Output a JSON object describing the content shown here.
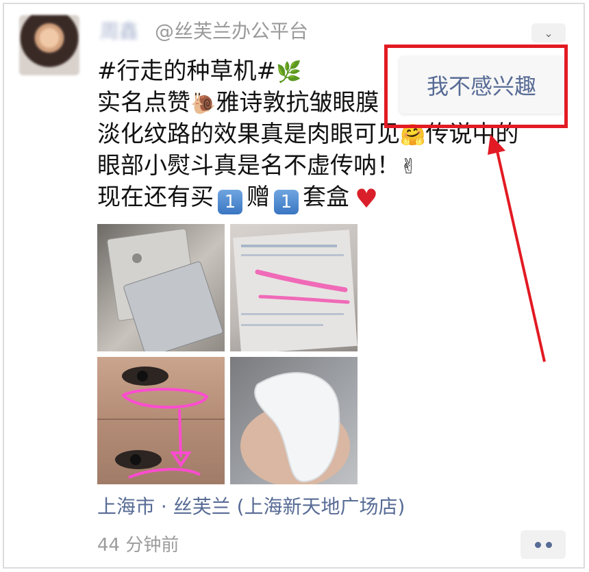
{
  "post": {
    "author_name": "周鑫",
    "handle": "@丝芙兰办公平台",
    "lines": {
      "line1_text": "#行走的种草机#",
      "line1_emoji": "🌿",
      "line2_text_a": "实名点赞",
      "line2_emoji": "🐌",
      "line2_text_b": "雅诗敦抗皱眼膜",
      "line3_text_a": "淡化纹路的效果真是肉眼可见",
      "line3_emoji": "🤗",
      "line3_text_b": "传说中的",
      "line4_text": "眼部小熨斗真是名不虚传呐！",
      "line4_emoji": "✌",
      "line5_text_a": "现在还有买",
      "keycap_1": "1",
      "line5_text_b": "赠",
      "keycap_2": "1",
      "line5_text_c": "套盒",
      "heart": "♥"
    },
    "location": "上海市 · 丝芙兰 (上海新天地广场店)",
    "time": "44 分钟前"
  },
  "menu": {
    "not_interested": "我不感兴趣"
  },
  "icons": {
    "more": "chevron-down-icon",
    "actions": "more-dots-icon"
  },
  "colors": {
    "link": "#576b95",
    "highlight": "#e21a23",
    "muted": "#9c9c9c"
  }
}
